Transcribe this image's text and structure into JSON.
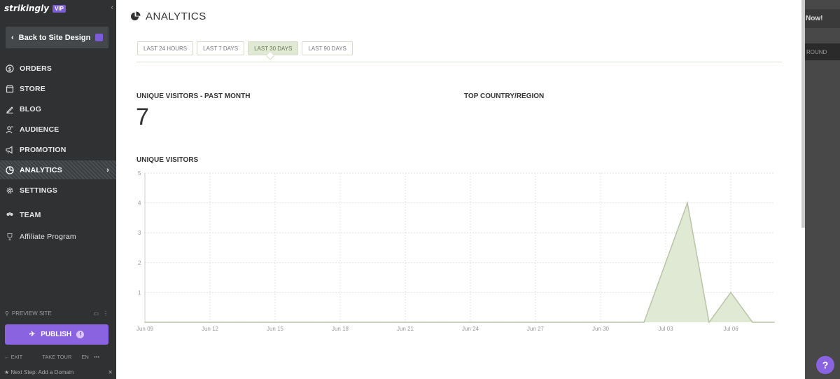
{
  "sidebar": {
    "logo": "strikingly",
    "badge": "VIP",
    "back_label": "Back to Site Design",
    "items": [
      {
        "label": "ORDERS",
        "icon": "dollar-circle-icon"
      },
      {
        "label": "STORE",
        "icon": "store-icon"
      },
      {
        "label": "BLOG",
        "icon": "pen-icon"
      },
      {
        "label": "AUDIENCE",
        "icon": "people-icon"
      },
      {
        "label": "PROMOTION",
        "icon": "megaphone-icon"
      },
      {
        "label": "ANALYTICS",
        "icon": "pie-chart-icon"
      },
      {
        "label": "SETTINGS",
        "icon": "gear-icon"
      },
      {
        "label": "TEAM",
        "icon": "team-icon"
      },
      {
        "label": "Affiliate Program",
        "icon": "trophy-icon"
      }
    ],
    "preview_label": "PREVIEW SITE",
    "publish_label": "PUBLISH",
    "exit_label": "EXIT",
    "tour_label": "TAKE TOUR",
    "lang_label": "EN",
    "next_step": "Next Step: Add a Domain"
  },
  "main": {
    "title": "ANALYTICS",
    "tabs": [
      "LAST 24 HOURS",
      "LAST 7 DAYS",
      "LAST 30 DAYS",
      "LAST 90 DAYS"
    ],
    "active_tab": "LAST 30 DAYS",
    "unique_visitors_label": "UNIQUE VISITORS - PAST MONTH",
    "unique_visitors_value": "7",
    "top_country_label": "TOP COUNTRY/REGION",
    "chart_label": "UNIQUE VISITORS"
  },
  "right_panel": {
    "now_label": "Now!",
    "round_label": "ROUND",
    "help_label": "?"
  },
  "colors": {
    "sidebar_bg": "#2f3133",
    "accent": "#8a63e0",
    "chart_fill": "#dfe9d3",
    "chart_line": "#b9c4a8"
  },
  "chart_data": {
    "type": "area",
    "title": "UNIQUE VISITORS",
    "x_ticks": [
      "Jun 09",
      "Jun 12",
      "Jun 15",
      "Jun 18",
      "Jun 21",
      "Jun 24",
      "Jun 27",
      "Jun 30",
      "Jul 03",
      "Jul 06"
    ],
    "x": [
      "Jun 09",
      "Jun 10",
      "Jun 11",
      "Jun 12",
      "Jun 13",
      "Jun 14",
      "Jun 15",
      "Jun 16",
      "Jun 17",
      "Jun 18",
      "Jun 19",
      "Jun 20",
      "Jun 21",
      "Jun 22",
      "Jun 23",
      "Jun 24",
      "Jun 25",
      "Jun 26",
      "Jun 27",
      "Jun 28",
      "Jun 29",
      "Jun 30",
      "Jul 01",
      "Jul 02",
      "Jul 03",
      "Jul 04",
      "Jul 05",
      "Jul 06",
      "Jul 07",
      "Jul 08"
    ],
    "values": [
      0,
      0,
      0,
      0,
      0,
      0,
      0,
      0,
      0,
      0,
      0,
      0,
      0,
      0,
      0,
      0,
      0,
      0,
      0,
      0,
      0,
      0,
      0,
      0,
      2,
      4,
      0,
      1,
      0,
      0
    ],
    "y_ticks": [
      1,
      2,
      3,
      4,
      5
    ],
    "ylim": [
      0,
      5
    ],
    "grid": true
  }
}
